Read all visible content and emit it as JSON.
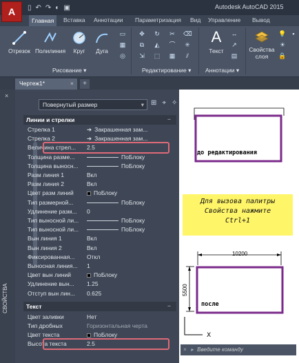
{
  "window": {
    "app_button": "A",
    "title": "Autodesk AutoCAD 2015"
  },
  "ribbon": {
    "tabs": [
      "Главная",
      "Вставка",
      "Аннотации",
      "Параметризация",
      "Вид",
      "Управление",
      "Вывод"
    ],
    "tools": {
      "line": "Отрезок",
      "polyline": "Полилиния",
      "circle": "Круг",
      "arc": "Дуга",
      "text": "Текст",
      "properties_line1": "Свойства",
      "properties_line2": "слоя"
    },
    "panels": {
      "draw": "Рисование",
      "modify": "Редактирование",
      "annotation": "Аннотации"
    }
  },
  "document": {
    "tab": "Чертеж1*",
    "close": "×",
    "new": "+"
  },
  "palette": {
    "vertical_title": "СВОЙСТВА",
    "selector": "Повернутый размер",
    "sections": {
      "lines": "Линии и стрелки",
      "text": "Текст"
    },
    "rows_lines": [
      {
        "label": "Стрелка 1",
        "value": "Закрашенная зам..."
      },
      {
        "label": "Стрелка 2",
        "value": "Закрашенная зам..."
      },
      {
        "label": "Величина стрел...",
        "value": "2.5"
      },
      {
        "label": "Толщина разме...",
        "value": "ПоБлоку"
      },
      {
        "label": "Толщина выносн...",
        "value": "ПоБлоку"
      },
      {
        "label": "Разм линия 1",
        "value": "Вкл"
      },
      {
        "label": "Разм линия 2",
        "value": "Вкл"
      },
      {
        "label": "Цвет разм линий",
        "value": "ПоБлоку"
      },
      {
        "label": "Тип размерной...",
        "value": "ПоБлоку"
      },
      {
        "label": "Удлинение разм...",
        "value": "0"
      },
      {
        "label": "Тип выносной ли...",
        "value": "ПоБлоку"
      },
      {
        "label": "Тип выносной ли...",
        "value": "ПоБлоку"
      },
      {
        "label": "Вын линия 1",
        "value": "Вкл"
      },
      {
        "label": "Вын линия 2",
        "value": "Вкл"
      },
      {
        "label": "Фиксированная...",
        "value": "Откл"
      },
      {
        "label": "Выносная линия...",
        "value": "1"
      },
      {
        "label": "Цвет вын линий",
        "value": "ПоБлоку"
      },
      {
        "label": "Удлинение вын...",
        "value": "1.25"
      },
      {
        "label": "Отступ вын лин...",
        "value": "0.625"
      }
    ],
    "rows_text": [
      {
        "label": "Цвет заливки",
        "value": "Нет"
      },
      {
        "label": "Тип дробных",
        "value": "Горизонтальная черта"
      },
      {
        "label": "Цвет текста",
        "value": "ПоБлоку"
      },
      {
        "label": "Высота текста",
        "value": "2.5"
      }
    ]
  },
  "drawing": {
    "before_label": "до редактирования",
    "after_label": "после",
    "dim_width": "10200",
    "dim_height": "5500",
    "note": [
      "Для вызова палитры",
      "Свойства нажмите",
      "Ctrl+1"
    ],
    "command_placeholder": "Введите команду"
  },
  "colors": {
    "highlight": "#e06a78",
    "rect": "#7a2a8a",
    "note_bg": "#fff568",
    "app_red": "#b0201d"
  }
}
